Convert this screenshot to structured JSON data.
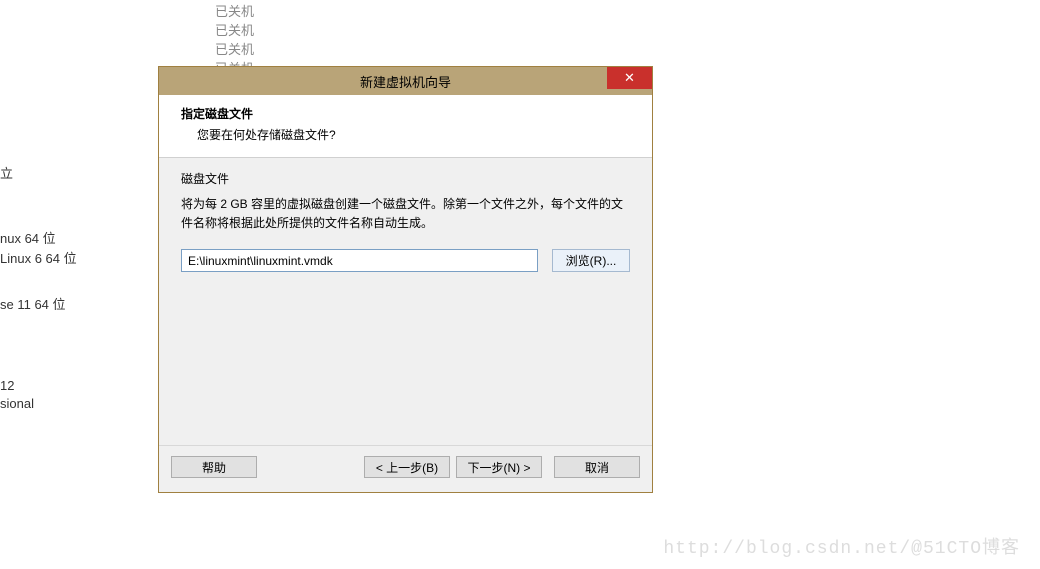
{
  "background": {
    "status1": "已关机",
    "status2": "已关机",
    "status3": "已关机",
    "status4": "已关机",
    "left_marker": "立",
    "item1": "nux 64 位",
    "item2": "Linux 6 64 位",
    "item3": "se 11 64 位",
    "item4": "12",
    "item5": "sional"
  },
  "dialog": {
    "title": "新建虚拟机向导",
    "header_title": "指定磁盘文件",
    "header_subtitle": "您要在何处存储磁盘文件?",
    "section_label": "磁盘文件",
    "section_description": "将为每 2 GB 容里的虚拟磁盘创建一个磁盘文件。除第一个文件之外，每个文件的文件名称将根据此处所提供的文件名称自动生成。",
    "path_value": "E:\\linuxmint\\linuxmint.vmdk",
    "browse_label": "浏览(R)...",
    "help_label": "帮助",
    "back_label": "< 上一步(B)",
    "next_label": "下一步(N) >",
    "cancel_label": "取消"
  },
  "watermark": "http://blog.csdn.net/@51CTO博客"
}
